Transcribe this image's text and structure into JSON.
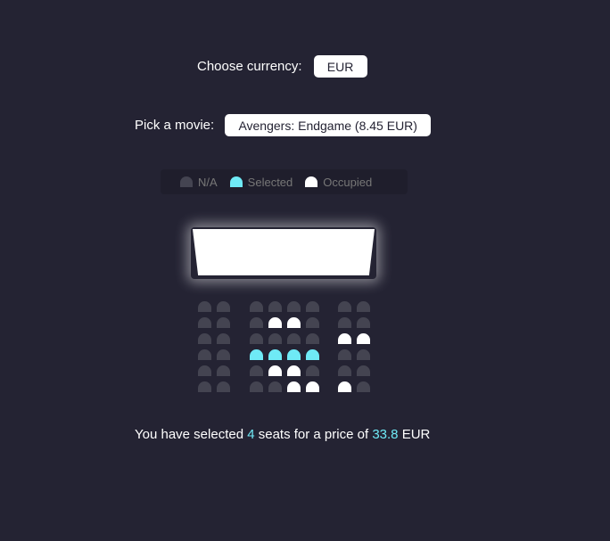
{
  "currency": {
    "label": "Choose currency:",
    "value": "EUR"
  },
  "movie": {
    "label": "Pick a movie:",
    "value": "Avengers: Endgame (8.45 EUR)"
  },
  "legend": {
    "items": [
      {
        "label": "N/A",
        "status": "na"
      },
      {
        "label": "Selected",
        "status": "selected"
      },
      {
        "label": "Occupied",
        "status": "occupied"
      }
    ]
  },
  "colors": {
    "background": "#242333",
    "seat_na": "#444451",
    "seat_selected": "#6feaf6",
    "seat_occupied": "#ffffff"
  },
  "seats": {
    "rows": [
      [
        "na",
        "na",
        "na",
        "na",
        "na",
        "na",
        "na",
        "na"
      ],
      [
        "na",
        "na",
        "na",
        "occupied",
        "occupied",
        "na",
        "na",
        "na"
      ],
      [
        "na",
        "na",
        "na",
        "na",
        "na",
        "na",
        "occupied",
        "occupied"
      ],
      [
        "na",
        "na",
        "selected",
        "selected",
        "selected",
        "selected",
        "na",
        "na"
      ],
      [
        "na",
        "na",
        "na",
        "occupied",
        "occupied",
        "na",
        "na",
        "na"
      ],
      [
        "na",
        "na",
        "na",
        "na",
        "occupied",
        "occupied",
        "occupied",
        "na"
      ]
    ]
  },
  "summary": {
    "prefix": "You have selected",
    "count": "4",
    "middle": "seats for a price of",
    "price": "33.8",
    "currency": "EUR"
  }
}
